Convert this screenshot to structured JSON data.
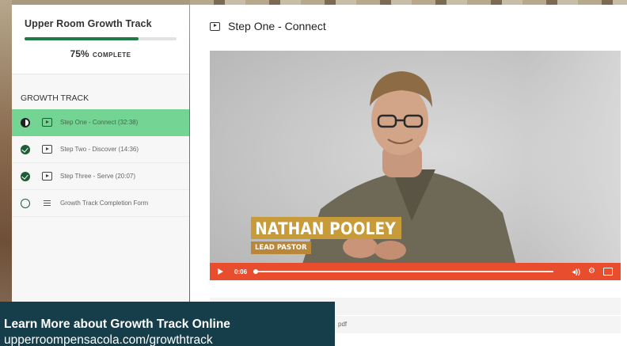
{
  "sidebar": {
    "course_title": "Upper Room Growth Track",
    "progress": {
      "percent": 75,
      "label": "75%",
      "word": "COMPLETE"
    },
    "section_label": "GROWTH TRACK",
    "lessons": [
      {
        "label": "Step One - Connect (32:38)",
        "status": "in-progress",
        "icon": "video-icon",
        "active": true
      },
      {
        "label": "Step Two - Discover (14:36)",
        "status": "complete",
        "icon": "video-icon",
        "active": false
      },
      {
        "label": "Step Three - Serve (20:07)",
        "status": "complete",
        "icon": "video-icon",
        "active": false
      },
      {
        "label": "Growth Track Completion Form",
        "status": "not-started",
        "icon": "form-icon",
        "active": false
      }
    ]
  },
  "main": {
    "lesson_title": "Step One - Connect",
    "video": {
      "lower_third_name": "NATHAN POOLEY",
      "lower_third_role": "LEAD PASTOR",
      "current_time": "0:06",
      "volume_label": "◂))",
      "controls_color": "#e84e2e"
    },
    "attachment_suffix": "pdf"
  },
  "banner": {
    "title": "Learn More about Growth Track Online",
    "url": "upperroompensacola.com/growthtrack"
  },
  "colors": {
    "accent_green": "#73d494",
    "progress_green": "#1f7a45",
    "banner_bg": "#163d4a",
    "lower_third_gold": "#c79a3a"
  }
}
